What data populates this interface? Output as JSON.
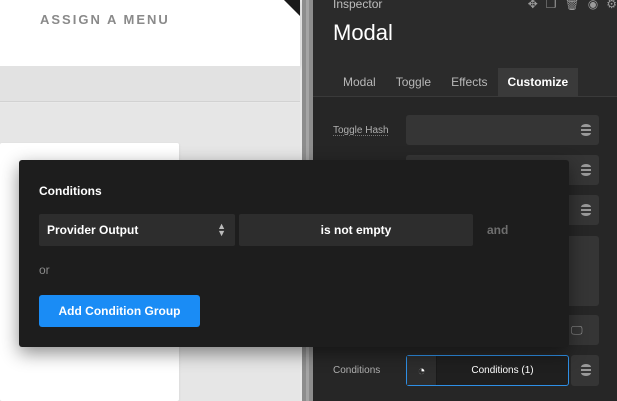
{
  "canvas": {
    "menu_label": "ASSIGN A MENU"
  },
  "inspector": {
    "label": "Inspector",
    "title": "Modal",
    "header_icons": [
      "move-icon",
      "copy-icon",
      "delete-icon",
      "eye-icon",
      "gear-icon"
    ],
    "tabs": [
      {
        "label": "Modal",
        "active": false
      },
      {
        "label": "Toggle",
        "active": false
      },
      {
        "label": "Effects",
        "active": false
      },
      {
        "label": "Customize",
        "active": true
      }
    ],
    "toggle_hash_label": "Toggle Hash",
    "conditions_label": "Conditions",
    "conditions_button": "Conditions (1)"
  },
  "popup": {
    "title": "Conditions",
    "provider_select": "Provider Output",
    "operator": "is not empty",
    "and_label": "and",
    "or_label": "or",
    "add_group_button": "Add Condition Group"
  },
  "colors": {
    "accent": "#1a8cf5",
    "panel_bg": "#2b2b2b",
    "popup_bg": "#1d1d1d"
  }
}
